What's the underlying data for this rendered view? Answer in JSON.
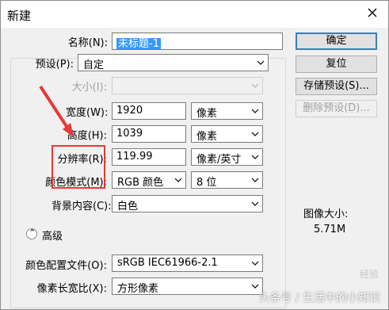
{
  "window": {
    "title": "新建"
  },
  "form": {
    "name_label": "名称(N):",
    "name_value": "未标题-1",
    "preset_label": "预设(P):",
    "preset_value": "自定",
    "size_label": "大小(I):",
    "width_label": "宽度(W):",
    "width_value": "1920",
    "width_unit": "像素",
    "height_label": "高度(H):",
    "height_value": "1039",
    "height_unit": "像素",
    "resolution_label": "分辨率(R):",
    "resolution_value": "119.99",
    "resolution_unit": "像素/英寸",
    "color_mode_label": "颜色模式(M):",
    "color_mode_value": "RGB 颜色",
    "bit_depth_value": "8 位",
    "background_label": "背景内容(C):",
    "background_value": "白色",
    "advanced_label": "高级",
    "color_profile_label": "颜色配置文件(O):",
    "color_profile_value": "sRGB IEC61966-2.1",
    "pixel_aspect_label": "像素长宽比(X):",
    "pixel_aspect_value": "方形像素"
  },
  "buttons": {
    "ok": "确定",
    "reset": "复位",
    "save_preset": "存储预设(S)...",
    "delete_preset": "删除预设(D)..."
  },
  "info": {
    "image_size_label": "图像大小:",
    "image_size_value": "5.71M"
  },
  "watermark": {
    "text": "头条号 / 生活中的小知识",
    "logo_text": "经验"
  },
  "colors": {
    "accent": "#3399ff",
    "highlight": "#e53935"
  }
}
